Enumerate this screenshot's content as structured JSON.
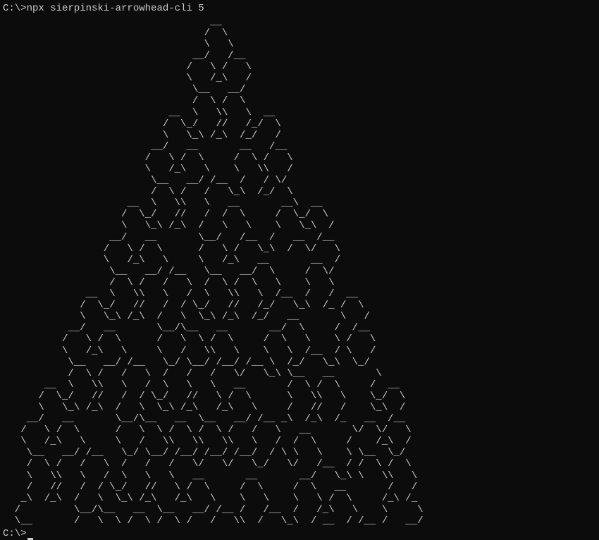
{
  "terminal": {
    "prompt1": "C:\\>",
    "command1": "npx sierpinski-arrowhead-cli 5",
    "prompt2": "C:\\>",
    "ascii_art": "                                   __\n                                  /  \\\n                                  \\   \\\n                                __/   /__\n                               /   \\ /   \\\n                               \\   /_\\   /\n                                \\__   __/\n                                /  \\ /  \\\n                            __  \\   \\\\   \\  __\n                           /  \\_/   //   /_/  \\\n                           \\   \\_\\ /_\\  /_/   /\n                         __/   __       __   /__\n                        /   \\ /  \\     /  \\ /   \\\n                        \\   /_\\   \\    \\   \\\\   /\n                         \\__   __/ /__  /   / \\/\n                         /  \\ /   /   \\_\\  /_/  \\\n                     __  \\   \\\\   \\   __       __\\  __\n                    /  \\_/   //   /  /  \\     /  \\_/  \\\n                    \\   \\_\\ /_\\  /   \\   \\    \\   \\_\\  /\n                  __/   __       \\__/   /__  /   __  /__\n                 /   \\ /  \\      /   \\ /   \\_\\  /  \\/   \\\n                 \\   /_\\   \\     \\   /_\\   __       __  /\n                  \\__   __/ /__   \\__   __/  \\     /  \\/\n                  /  \\ /   /   \\  /  \\ /  \\   \\    \\   \\\n              __  \\   \\\\   \\   /  \\   \\\\   \\  /__  /   /  __\n             /  \\_/   //   /  / \\_/   //   /_/   \\_\\  /_ /  \\\n             \\   \\_\\ /_\\  /   \\  \\_\\ /_\\  /_/   __       \\   /\n           __/   __       \\__/\\__   __       __/  \\     /  /__\n          /   \\ /  \\      /   \\  \\ /  \\     /  \\   \\    \\ /   \\\n          \\   /_\\   \\     \\   /   \\\\   \\    \\   \\  /__  / \\   /\n           \\__   __/ /__   \\_/ \\__/ /__/ /__ \\  /_/   \\_\\  \\_/\n           /  \\ /   /   \\  /   /   /   \\/   \\_\\ \\__   __       \\\n       __  \\   \\\\   \\   /  \\   \\   \\   __       /  \\ /  \\     /  __\n      /  \\_/   //   /  / \\_/   //   \\ /  \\      \\   \\\\   \\    \\_/  \\\n      \\   \\_\\ /_\\  /   \\  \\_\\ /_\\   /_\\   \\     /   //   /    \\_\\  /\n    __/   __       \\__/\\__   __  \\__   __/ /__ _\\  /_\\  /_   __  /__\n   /   \\ /  \\      /   \\  \\ /  \\ /  \\ /   /   \\   __       \\/  \\/   \\\n   \\   /_\\   \\     \\   /   \\\\   \\\\   \\\\   \\   /  /  \\     /    /_\\  /\n    \\__   __/ /__   \\_/ \\__/ /__/ /__/ /__/  / \\ \\   \\    \\ \\__  \\_/\n    /  \\ /   /   \\  /   /   /   \\/   \\/   \\_/   \\/   /__  / /  \\ /  \\\n    \\   \\\\   \\   /  \\   \\   \\   __       __       __/   \\_\\ \\   \\\\   \\\n    /   //   /  / \\_/   //   \\ /  \\     /  \\     /  \\   __       /   /\n   _\\  /_\\  /   \\  \\_\\ /_\\   /_\\   \\    \\   \\    \\   \\ /  \\     /_\\ /_\n  /         \\__/\\__   __  \\__   __/ /__ /   /__  /   /_\\   \\    \\     \\\n  \\__       /   \\  \\ /  \\ /  \\ /   /   \\\\  /   \\_\\  / __  / /__ /   __/"
  }
}
